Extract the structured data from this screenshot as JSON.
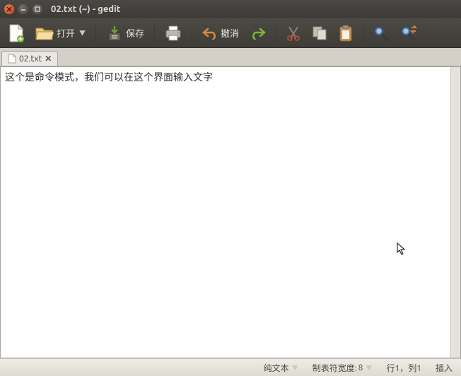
{
  "window": {
    "title": "02.txt (~) - gedit"
  },
  "toolbar": {
    "open": "打开",
    "save": "保存",
    "undo": "撤消"
  },
  "tab": {
    "filename": "02.txt"
  },
  "editor": {
    "text": "这个是命令模式，我们可以在这个界面输入文字"
  },
  "status": {
    "filetype": "纯文本",
    "tabwidth_label": "制表符宽度:",
    "tabwidth_value": "8",
    "position": "行1，列1",
    "mode": "插入"
  }
}
